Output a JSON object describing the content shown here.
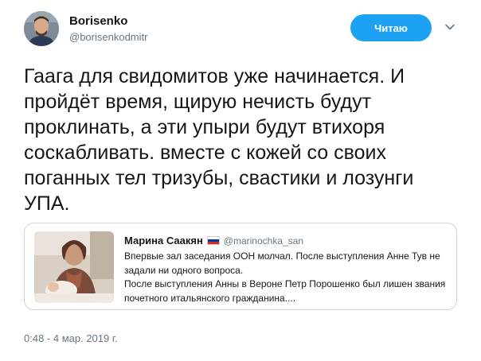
{
  "author": {
    "display_name": "Borisenko",
    "handle": "@borisenkodmitr",
    "avatar_icon": "profile-photo"
  },
  "follow_button": {
    "label": "Читаю",
    "color": "#1da1f2"
  },
  "tweet": {
    "text": "Гаага для свидомитов уже начинается. И пройдёт время, щирую нечисть будут проклинать, а эти упыри будут втихоря соскабливать. вместе с кожей со своих поганных тел тризубы, свастики и лозунги УПА."
  },
  "quoted_tweet": {
    "name": "Марина Саакян",
    "flag_icon": "russian-flag",
    "handle": "@marinochka_san",
    "paragraph_1": "Впервые зал заседания ООН молчал. После выступления Анне Тув не задали ни одного вопроса.",
    "paragraph_2": "После выступления Анны в Вероне Петр Порошенко был лишен звания почетного итальянского гражданина...."
  },
  "timestamp": "0:48 - 4 мар. 2019 г.",
  "colors": {
    "text": "#14171a",
    "secondary": "#657786",
    "border": "#ccd6dd",
    "accent": "#1da1f2"
  }
}
